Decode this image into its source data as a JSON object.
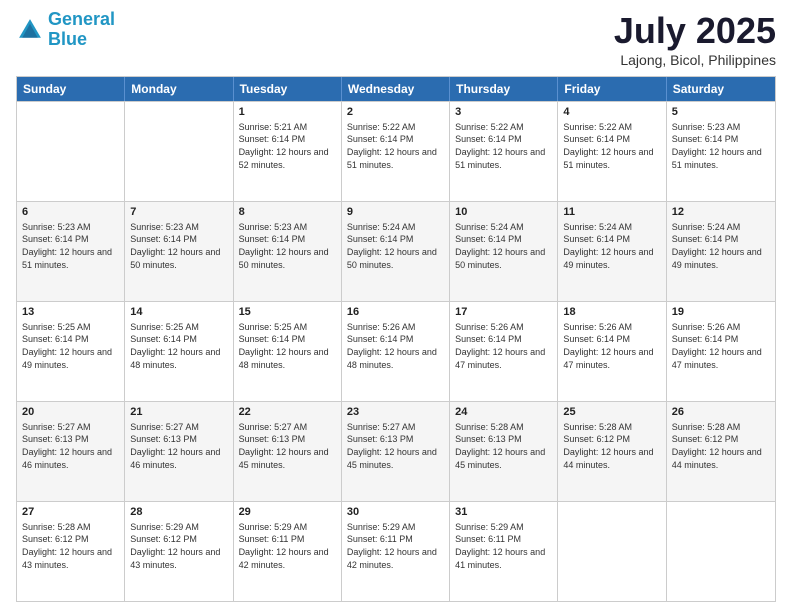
{
  "header": {
    "logo_line1": "General",
    "logo_line2": "Blue",
    "month": "July 2025",
    "location": "Lajong, Bicol, Philippines"
  },
  "days": [
    "Sunday",
    "Monday",
    "Tuesday",
    "Wednesday",
    "Thursday",
    "Friday",
    "Saturday"
  ],
  "rows": [
    [
      {
        "num": "",
        "sunrise": "",
        "sunset": "",
        "daylight": "",
        "empty": true
      },
      {
        "num": "",
        "sunrise": "",
        "sunset": "",
        "daylight": "",
        "empty": true
      },
      {
        "num": "1",
        "sunrise": "Sunrise: 5:21 AM",
        "sunset": "Sunset: 6:14 PM",
        "daylight": "Daylight: 12 hours and 52 minutes."
      },
      {
        "num": "2",
        "sunrise": "Sunrise: 5:22 AM",
        "sunset": "Sunset: 6:14 PM",
        "daylight": "Daylight: 12 hours and 51 minutes."
      },
      {
        "num": "3",
        "sunrise": "Sunrise: 5:22 AM",
        "sunset": "Sunset: 6:14 PM",
        "daylight": "Daylight: 12 hours and 51 minutes."
      },
      {
        "num": "4",
        "sunrise": "Sunrise: 5:22 AM",
        "sunset": "Sunset: 6:14 PM",
        "daylight": "Daylight: 12 hours and 51 minutes."
      },
      {
        "num": "5",
        "sunrise": "Sunrise: 5:23 AM",
        "sunset": "Sunset: 6:14 PM",
        "daylight": "Daylight: 12 hours and 51 minutes."
      }
    ],
    [
      {
        "num": "6",
        "sunrise": "Sunrise: 5:23 AM",
        "sunset": "Sunset: 6:14 PM",
        "daylight": "Daylight: 12 hours and 51 minutes."
      },
      {
        "num": "7",
        "sunrise": "Sunrise: 5:23 AM",
        "sunset": "Sunset: 6:14 PM",
        "daylight": "Daylight: 12 hours and 50 minutes."
      },
      {
        "num": "8",
        "sunrise": "Sunrise: 5:23 AM",
        "sunset": "Sunset: 6:14 PM",
        "daylight": "Daylight: 12 hours and 50 minutes."
      },
      {
        "num": "9",
        "sunrise": "Sunrise: 5:24 AM",
        "sunset": "Sunset: 6:14 PM",
        "daylight": "Daylight: 12 hours and 50 minutes."
      },
      {
        "num": "10",
        "sunrise": "Sunrise: 5:24 AM",
        "sunset": "Sunset: 6:14 PM",
        "daylight": "Daylight: 12 hours and 50 minutes."
      },
      {
        "num": "11",
        "sunrise": "Sunrise: 5:24 AM",
        "sunset": "Sunset: 6:14 PM",
        "daylight": "Daylight: 12 hours and 49 minutes."
      },
      {
        "num": "12",
        "sunrise": "Sunrise: 5:24 AM",
        "sunset": "Sunset: 6:14 PM",
        "daylight": "Daylight: 12 hours and 49 minutes."
      }
    ],
    [
      {
        "num": "13",
        "sunrise": "Sunrise: 5:25 AM",
        "sunset": "Sunset: 6:14 PM",
        "daylight": "Daylight: 12 hours and 49 minutes."
      },
      {
        "num": "14",
        "sunrise": "Sunrise: 5:25 AM",
        "sunset": "Sunset: 6:14 PM",
        "daylight": "Daylight: 12 hours and 48 minutes."
      },
      {
        "num": "15",
        "sunrise": "Sunrise: 5:25 AM",
        "sunset": "Sunset: 6:14 PM",
        "daylight": "Daylight: 12 hours and 48 minutes."
      },
      {
        "num": "16",
        "sunrise": "Sunrise: 5:26 AM",
        "sunset": "Sunset: 6:14 PM",
        "daylight": "Daylight: 12 hours and 48 minutes."
      },
      {
        "num": "17",
        "sunrise": "Sunrise: 5:26 AM",
        "sunset": "Sunset: 6:14 PM",
        "daylight": "Daylight: 12 hours and 47 minutes."
      },
      {
        "num": "18",
        "sunrise": "Sunrise: 5:26 AM",
        "sunset": "Sunset: 6:14 PM",
        "daylight": "Daylight: 12 hours and 47 minutes."
      },
      {
        "num": "19",
        "sunrise": "Sunrise: 5:26 AM",
        "sunset": "Sunset: 6:14 PM",
        "daylight": "Daylight: 12 hours and 47 minutes."
      }
    ],
    [
      {
        "num": "20",
        "sunrise": "Sunrise: 5:27 AM",
        "sunset": "Sunset: 6:13 PM",
        "daylight": "Daylight: 12 hours and 46 minutes."
      },
      {
        "num": "21",
        "sunrise": "Sunrise: 5:27 AM",
        "sunset": "Sunset: 6:13 PM",
        "daylight": "Daylight: 12 hours and 46 minutes."
      },
      {
        "num": "22",
        "sunrise": "Sunrise: 5:27 AM",
        "sunset": "Sunset: 6:13 PM",
        "daylight": "Daylight: 12 hours and 45 minutes."
      },
      {
        "num": "23",
        "sunrise": "Sunrise: 5:27 AM",
        "sunset": "Sunset: 6:13 PM",
        "daylight": "Daylight: 12 hours and 45 minutes."
      },
      {
        "num": "24",
        "sunrise": "Sunrise: 5:28 AM",
        "sunset": "Sunset: 6:13 PM",
        "daylight": "Daylight: 12 hours and 45 minutes."
      },
      {
        "num": "25",
        "sunrise": "Sunrise: 5:28 AM",
        "sunset": "Sunset: 6:12 PM",
        "daylight": "Daylight: 12 hours and 44 minutes."
      },
      {
        "num": "26",
        "sunrise": "Sunrise: 5:28 AM",
        "sunset": "Sunset: 6:12 PM",
        "daylight": "Daylight: 12 hours and 44 minutes."
      }
    ],
    [
      {
        "num": "27",
        "sunrise": "Sunrise: 5:28 AM",
        "sunset": "Sunset: 6:12 PM",
        "daylight": "Daylight: 12 hours and 43 minutes."
      },
      {
        "num": "28",
        "sunrise": "Sunrise: 5:29 AM",
        "sunset": "Sunset: 6:12 PM",
        "daylight": "Daylight: 12 hours and 43 minutes."
      },
      {
        "num": "29",
        "sunrise": "Sunrise: 5:29 AM",
        "sunset": "Sunset: 6:11 PM",
        "daylight": "Daylight: 12 hours and 42 minutes."
      },
      {
        "num": "30",
        "sunrise": "Sunrise: 5:29 AM",
        "sunset": "Sunset: 6:11 PM",
        "daylight": "Daylight: 12 hours and 42 minutes."
      },
      {
        "num": "31",
        "sunrise": "Sunrise: 5:29 AM",
        "sunset": "Sunset: 6:11 PM",
        "daylight": "Daylight: 12 hours and 41 minutes."
      },
      {
        "num": "",
        "sunrise": "",
        "sunset": "",
        "daylight": "",
        "empty": true
      },
      {
        "num": "",
        "sunrise": "",
        "sunset": "",
        "daylight": "",
        "empty": true
      }
    ]
  ]
}
